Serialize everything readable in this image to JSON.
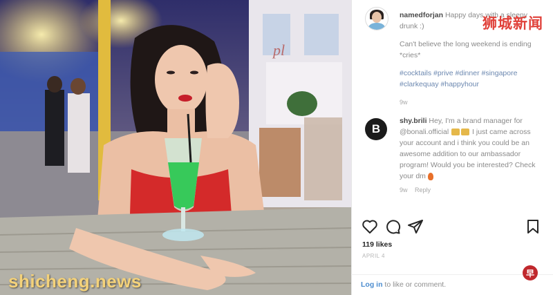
{
  "post": {
    "username": "namedforjan",
    "caption_line1": "Happy days with a sleepy drunk :)",
    "caption_line2": "Can't believe the long weekend is ending *cries*",
    "hashtags": "#cocktails #prive #dinner #singapore #clarkequay #happyhour",
    "time": "9w"
  },
  "comment": {
    "avatar_letter": "B",
    "username": "shy.brili",
    "text_part1": "Hey, I'm a brand manager for @bonali.official",
    "text_part2": "I just came across your account and i think you could be an awesome addition to our ambassador program! Would you be interested? Check your dm",
    "time": "9w",
    "reply_label": "Reply"
  },
  "actions": {
    "likes": "119 likes",
    "date": "APRIL 4"
  },
  "login": {
    "link": "Log in",
    "text": "to like or comment."
  },
  "watermarks": {
    "top_right": "狮城新闻",
    "bottom_left": "shicheng.news",
    "badge": "早"
  },
  "colors": {
    "tag_blue": "#6c88b0",
    "link_blue": "#4b8ccf",
    "brand_red": "#e0413a",
    "watermark_gold": "#f4d27a"
  },
  "icons": [
    "heart-icon",
    "comment-icon",
    "share-icon",
    "bookmark-icon"
  ]
}
